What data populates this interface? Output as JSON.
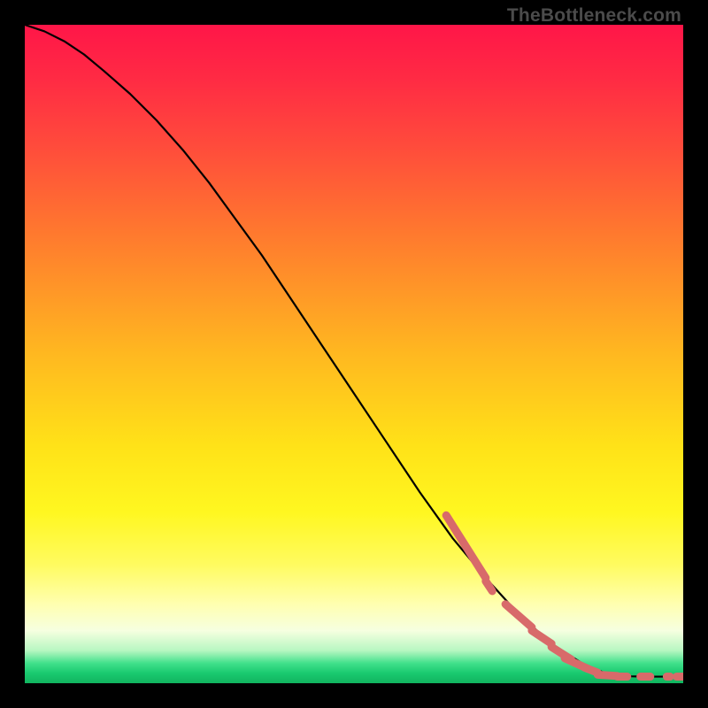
{
  "watermark": "TheBottleneck.com",
  "chart_data": {
    "type": "line",
    "title": "",
    "xlabel": "",
    "ylabel": "",
    "xlim": [
      0,
      100
    ],
    "ylim": [
      0,
      100
    ],
    "grid": false,
    "curve": {
      "x": [
        0,
        3,
        6,
        9,
        12,
        16,
        20,
        24,
        28,
        32,
        36,
        40,
        45,
        50,
        55,
        60,
        65,
        70,
        75,
        80,
        85,
        88,
        90,
        92,
        94,
        96,
        98,
        100
      ],
      "y": [
        100,
        99,
        97.5,
        95.5,
        93,
        89.5,
        85.5,
        81,
        76,
        70.5,
        65,
        59,
        51.5,
        44,
        36.5,
        29,
        22,
        16,
        10.5,
        6,
        2.8,
        1.6,
        1.2,
        1.05,
        1.0,
        1.0,
        1.0,
        1.0
      ]
    },
    "dash_segments": {
      "color": "#d86a6a",
      "width": 9,
      "segments": [
        {
          "x0": 64,
          "y0": 25.5,
          "x1": 70,
          "y1": 16.0
        },
        {
          "x0": 70,
          "y0": 15.5,
          "x1": 71,
          "y1": 14.0
        },
        {
          "x0": 73,
          "y0": 12.0,
          "x1": 77,
          "y1": 8.5
        },
        {
          "x0": 77,
          "y0": 8.0,
          "x1": 80,
          "y1": 6.0
        },
        {
          "x0": 80,
          "y0": 5.5,
          "x1": 83,
          "y1": 3.6
        },
        {
          "x0": 82,
          "y0": 3.8,
          "x1": 85.5,
          "y1": 2.2
        },
        {
          "x0": 85,
          "y0": 2.4,
          "x1": 87,
          "y1": 1.6
        },
        {
          "x0": 87,
          "y0": 1.3,
          "x1": 90,
          "y1": 1.1
        },
        {
          "x0": 90,
          "y0": 1.0,
          "x1": 91.5,
          "y1": 1.0
        },
        {
          "x0": 93.5,
          "y0": 1.0,
          "x1": 95,
          "y1": 1.0
        },
        {
          "x0": 97.5,
          "y0": 1.0,
          "x1": 98,
          "y1": 1.0
        },
        {
          "x0": 99,
          "y0": 1.0,
          "x1": 100,
          "y1": 1.0
        }
      ]
    }
  }
}
